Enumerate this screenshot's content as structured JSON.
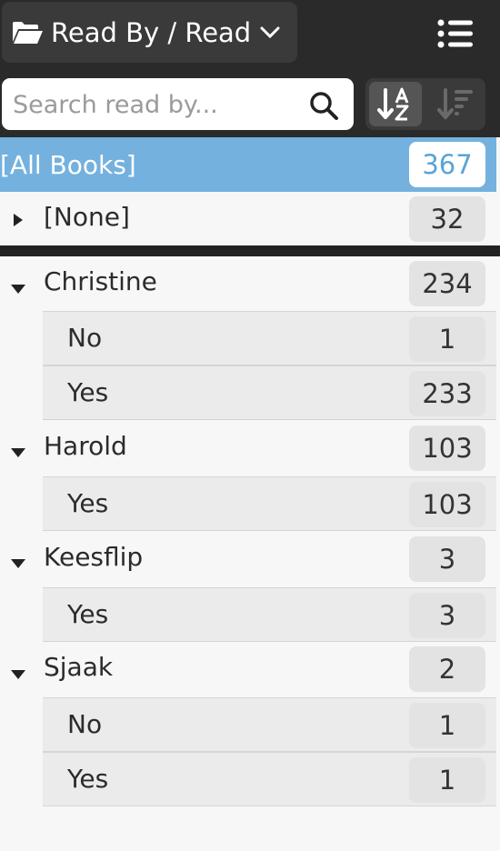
{
  "header": {
    "view_label": "Read By / Read",
    "icons": {
      "view": "folder-open-icon",
      "dropdown": "chevron-down-icon",
      "menu": "list-menu-icon"
    }
  },
  "toolbar": {
    "search_placeholder": "Search read by...",
    "search_value": "",
    "icons": {
      "search": "search-icon",
      "sort_alpha": "sort-alpha-icon",
      "sort_count": "sort-count-icon"
    }
  },
  "all_books": {
    "label": "[All Books]",
    "count": "367"
  },
  "groups": [
    {
      "label": "[None]",
      "count": "32",
      "expanded": false,
      "children": []
    },
    {
      "label": "Christine",
      "count": "234",
      "expanded": true,
      "children": [
        {
          "label": "No",
          "count": "1"
        },
        {
          "label": "Yes",
          "count": "233"
        }
      ]
    },
    {
      "label": "Harold",
      "count": "103",
      "expanded": true,
      "children": [
        {
          "label": "Yes",
          "count": "103"
        }
      ]
    },
    {
      "label": "Keesflip",
      "count": "3",
      "expanded": true,
      "children": [
        {
          "label": "Yes",
          "count": "3"
        }
      ]
    },
    {
      "label": "Sjaak",
      "count": "2",
      "expanded": true,
      "children": [
        {
          "label": "No",
          "count": "1"
        },
        {
          "label": "Yes",
          "count": "1"
        }
      ]
    }
  ],
  "colors": {
    "selected_row": "#74b1de",
    "header_bg": "#2a2a2a",
    "badge_bg": "#e3e3e3"
  }
}
